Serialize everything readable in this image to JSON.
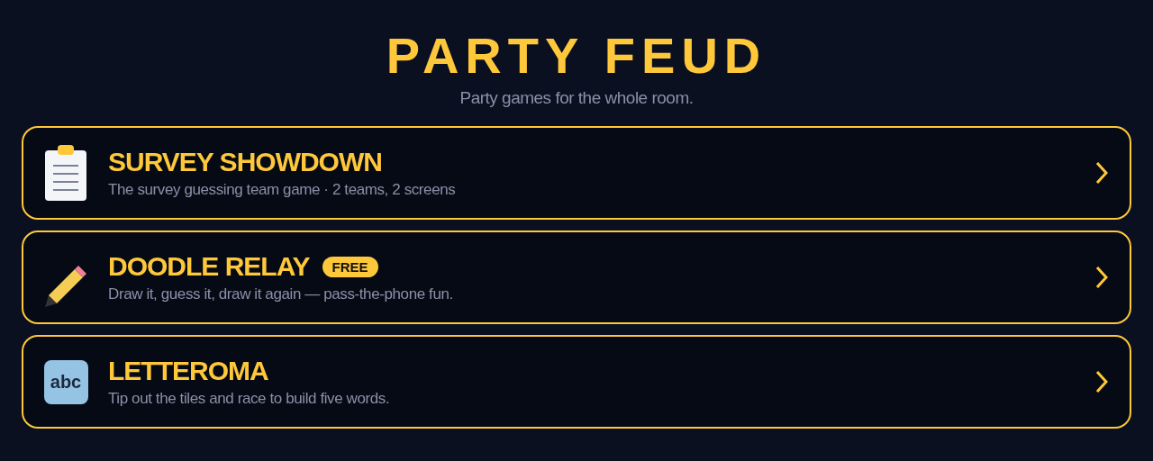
{
  "header": {
    "title": "PARTY FEUD",
    "subtitle": "Party games for the whole room."
  },
  "games": [
    {
      "icon": {
        "kind": "clipboard"
      },
      "title": "SURVEY SHOWDOWN",
      "description": "The survey guessing team game · 2 teams, 2 screens"
    },
    {
      "icon": {
        "kind": "pencil"
      },
      "title": "DOODLE RELAY",
      "badge": "FREE",
      "description": "Draw it, guess it, draw it again — pass-the-phone fun."
    },
    {
      "icon": {
        "kind": "tile",
        "text": "abc"
      },
      "title": "LETTEROMA",
      "description": "Tip out the tiles and race to build five words."
    }
  ]
}
